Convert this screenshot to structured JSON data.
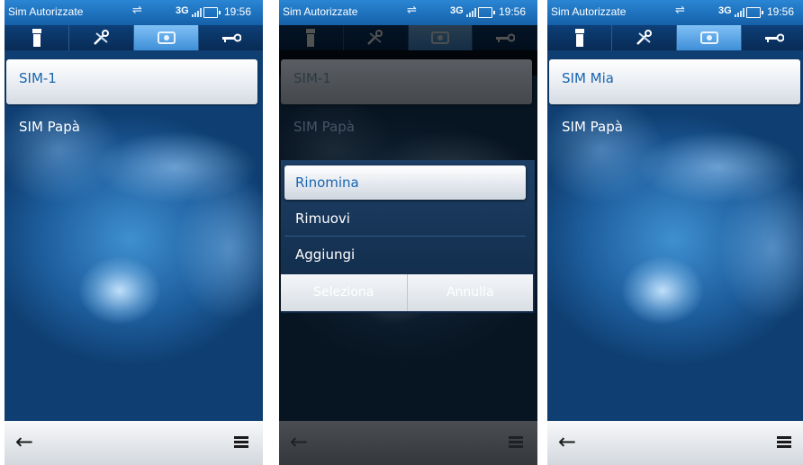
{
  "status_bar": {
    "title": "Sim Autorizzate",
    "network": "3G",
    "time": "19:56"
  },
  "tab_icons": [
    "phone-icon",
    "tools-icon",
    "sim-card-icon",
    "key-icon"
  ],
  "screens": [
    {
      "name": "list",
      "list_items": [
        "SIM-1",
        "SIM Papà"
      ],
      "selected_index": 0
    },
    {
      "name": "options-menu",
      "list_items": [
        "SIM-1",
        "SIM Papà"
      ],
      "menu_items": [
        "Rinomina",
        "Rimuovi",
        "Aggiungi"
      ],
      "softkeys": {
        "left": "Seleziona",
        "right": "Annulla"
      }
    },
    {
      "name": "renamed",
      "list_items": [
        "SIM Mia",
        "SIM Papà"
      ],
      "selected_index": 0
    }
  ],
  "bottom_bar": {
    "back_icon": "back-arrow-icon",
    "menu_icon": "menu-icon"
  },
  "colors": {
    "accent": "#1765b0",
    "status_bar": "#1f74c2",
    "tab_active": "#5ea8e8"
  }
}
